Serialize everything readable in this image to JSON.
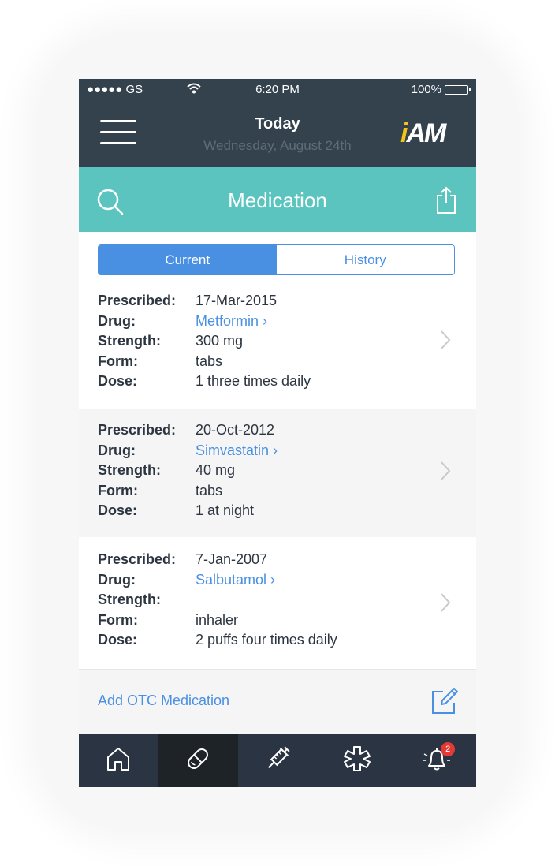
{
  "status_bar": {
    "carrier": "●●●●● GS",
    "time": "6:20 PM",
    "battery": "100%"
  },
  "header": {
    "title": "Today",
    "subtitle": "Wednesday, August 24th",
    "logo_i": "i",
    "logo_am": "AM"
  },
  "section": {
    "title": "Medication"
  },
  "tabs": {
    "current": "Current",
    "history": "History",
    "active": "Current"
  },
  "labels": {
    "prescribed": "Prescribed:",
    "drug": "Drug:",
    "strength": "Strength:",
    "form": "Form:",
    "dose": "Dose:"
  },
  "medications": [
    {
      "prescribed": "17-Mar-2015",
      "drug": "Metformin ›",
      "strength": "300 mg",
      "form": "tabs",
      "dose": "1 three times daily"
    },
    {
      "prescribed": "20-Oct-2012",
      "drug": "Simvastatin ›",
      "strength": "40 mg",
      "form": "tabs",
      "dose": "1 at night"
    },
    {
      "prescribed": "7-Jan-2007",
      "drug": "Salbutamol ›",
      "strength": "",
      "form": "inhaler",
      "dose": "2 puffs four times daily"
    }
  ],
  "add_otc": {
    "label": "Add OTC Medication"
  },
  "tab_bar": {
    "items": [
      "home-icon",
      "pill-icon",
      "syringe-icon",
      "medical-star-icon",
      "bell-icon"
    ],
    "active_index": 1,
    "notification_badge": "2"
  },
  "colors": {
    "header_bg": "#34424e",
    "teal": "#5bc4bf",
    "accent_blue": "#4a90e2",
    "tabbar_bg": "#2b3442",
    "logo_yellow": "#f5c518",
    "badge_red": "#e53935"
  }
}
